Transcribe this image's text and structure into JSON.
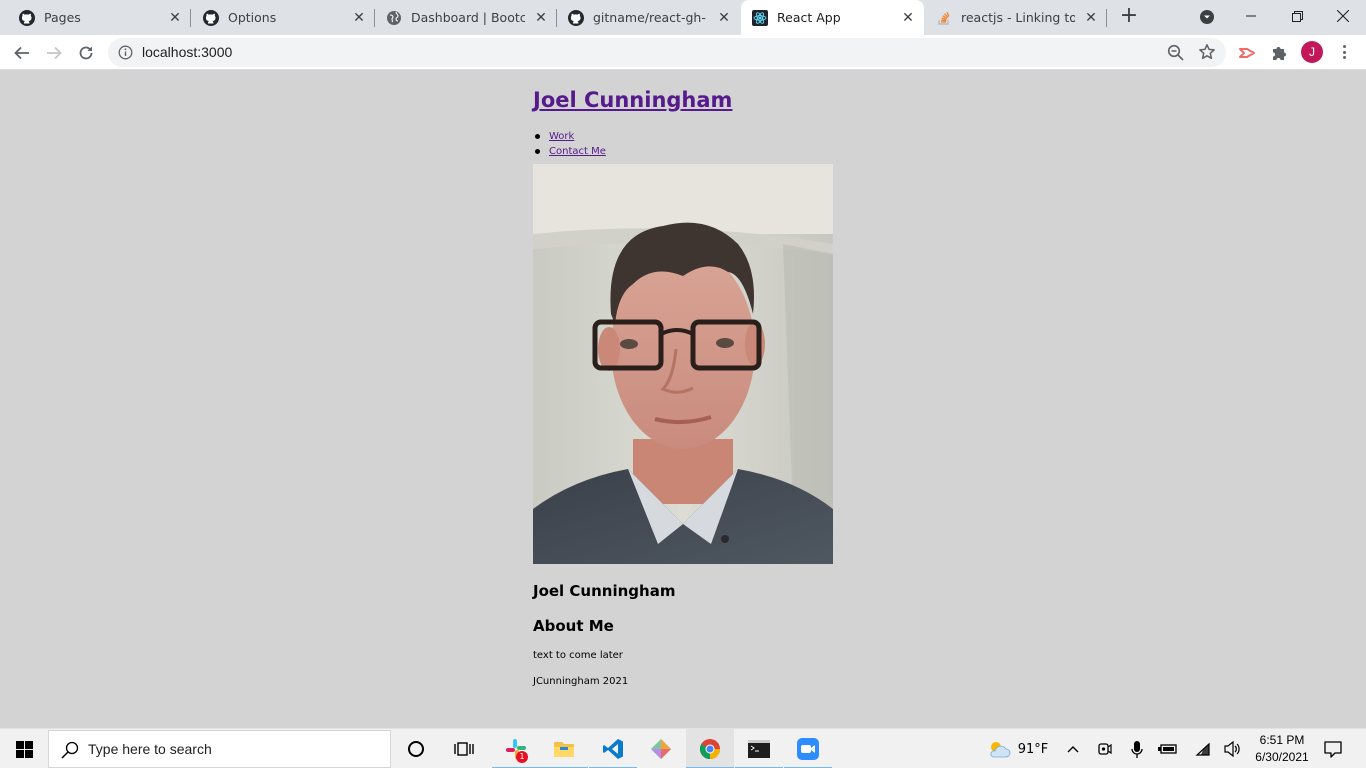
{
  "browser": {
    "tabs": [
      {
        "title": "Pages",
        "icon": "github-icon"
      },
      {
        "title": "Options",
        "icon": "github-icon"
      },
      {
        "title": "Dashboard | Bootcamp",
        "icon": "globe-icon"
      },
      {
        "title": "gitname/react-gh-pages",
        "icon": "github-icon"
      },
      {
        "title": "React App",
        "icon": "react-icon",
        "active": true
      },
      {
        "title": "reactjs - Linking to css",
        "icon": "stackoverflow-icon"
      }
    ],
    "url": "localhost:3000",
    "profile_initial": "J",
    "accent_color": "#1a73e8"
  },
  "page": {
    "site_title": "Joel Cunningham",
    "nav": [
      {
        "label": "Work"
      },
      {
        "label": "Contact Me"
      }
    ],
    "name_heading": "Joel Cunningham",
    "about_heading": "About Me",
    "about_text": "text to come later",
    "footer_text": "JCunningham 2021",
    "background_color": "#d3d3d3",
    "link_color": "#551a8b"
  },
  "taskbar": {
    "search_placeholder": "Type here to search",
    "slack_badge": "1",
    "weather_temp": "91°F",
    "time": "6:51 PM",
    "date": "6/30/2021"
  }
}
